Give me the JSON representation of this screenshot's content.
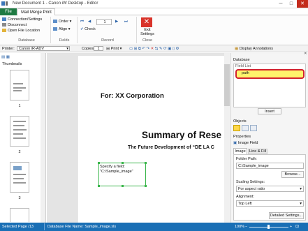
{
  "title_bar": {
    "title": "New Document 1 - Canon iW Desktop - Editor",
    "minimize": "─",
    "maximize": "□",
    "close": "✕"
  },
  "tabs": {
    "file": "File",
    "mail_merge_print": "Mail Merge Print"
  },
  "ribbon": {
    "connection_settings": "Connection/Settings",
    "disconnect": "Disconnect",
    "open_file_location": "Open File Location",
    "database_group": "Database",
    "order": "Order",
    "align": "Align",
    "fields_group": "Fields",
    "record_value": "1",
    "check": "Check",
    "record_group": "Record",
    "exit_settings": "Exit Settings",
    "close_group": "Close"
  },
  "toolbar": {
    "printer_label": "Printer:",
    "printer_value": "Canon iR-ADV",
    "copies_label": "Copies:",
    "copies_value": "1",
    "print": "Print",
    "display_annotations": "Display Annotations"
  },
  "thumbnails": {
    "title": "Thumbnails",
    "pages": [
      "1",
      "2",
      "3"
    ]
  },
  "document": {
    "line1": "For: XX Corporation",
    "heading": "Summary of Rese",
    "subheading": "The Future Development of “DE LA C",
    "field_line1": "Specify a field:",
    "field_line2": "\"C:\\Sample_image\""
  },
  "right_panel": {
    "database_header": "Database",
    "field_list_header": "Field List",
    "selected_field": "path",
    "insert": "Insert",
    "objects_header": "Objects",
    "properties_header": "Properties",
    "image_field": "Image Field",
    "tab_image": "Image",
    "tab_line_fill": "Line & Fill",
    "folder_path_label": "Folder Path:",
    "folder_path_value": "C:\\Sample_image",
    "browse": "Browse...",
    "scaling_label": "Scaling Settings:",
    "scaling_value": "For aspect ratio",
    "alignment_label": "Alignment:",
    "alignment_value": "Top Left",
    "detailed_settings": "Detailed Settings..."
  },
  "status_bar": {
    "selected_page": "Selected Page /13",
    "db_file": "Database File Name: Sample_image.xls",
    "zoom": "100%"
  },
  "colors": {
    "accent": "#1a6fb5",
    "file_tab": "#1f7a43",
    "highlight_field": "#fff36b",
    "highlight_border": "#d2202f",
    "field_box_border": "#39b54a"
  }
}
